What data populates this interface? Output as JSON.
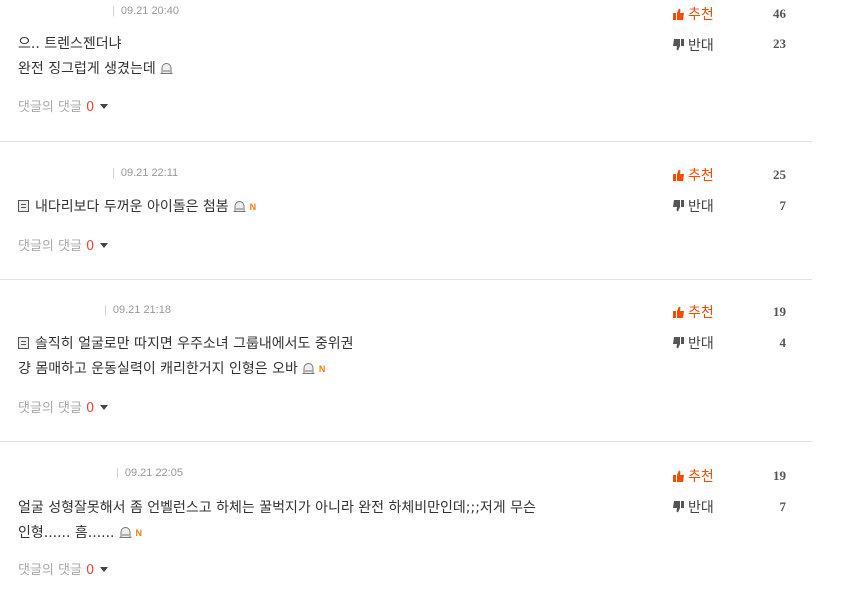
{
  "reply_label": "댓글의 댓글",
  "recommend_label": "추천",
  "oppose_label": "반대",
  "separator": "|",
  "new_badge": "N",
  "colors": {
    "recommend": "#ff4800",
    "reply_count": "#e8473b",
    "new_badge": "#ff7a00",
    "divider": "#e2e2e2"
  },
  "comments": [
    {
      "datetime": "09.21 20:40",
      "lines": [
        "으.. 트렌스젠더냐",
        "완전 징그럽게 생겼는데"
      ],
      "reply_count": "0",
      "recommend": "46",
      "oppose": "23"
    },
    {
      "datetime": "09.21 22:11",
      "lines": [
        "내다리보다 두꺼운 아이돌은 첨봄"
      ],
      "reply_count": "0",
      "recommend": "25",
      "oppose": "7"
    },
    {
      "datetime": "09.21 21:18",
      "lines": [
        "솔직히 얼굴로만 따지면 우주소녀 그룹내에서도 중위권",
        "걍 몸매하고 운동실력이 캐리한거지 인형은 오바"
      ],
      "reply_count": "0",
      "recommend": "19",
      "oppose": "4"
    },
    {
      "datetime": "09.21 22:05",
      "lines": [
        "얼굴 성형잘못해서 좀 언벨런스고 하체는 꿀벅지가 아니라 완전 하체비만인데;;;저게 무슨",
        "인형...... 흠......"
      ],
      "reply_count": "0",
      "recommend": "19",
      "oppose": "7"
    }
  ]
}
